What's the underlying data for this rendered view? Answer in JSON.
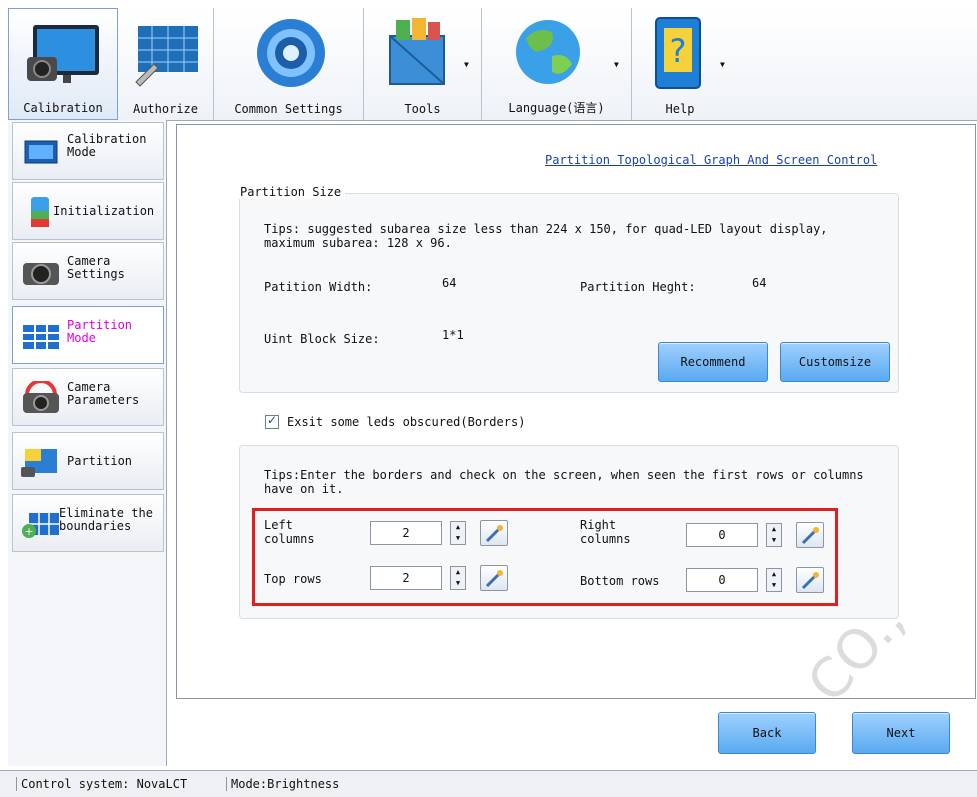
{
  "toolbar": {
    "items": [
      {
        "label": "Calibration",
        "icon": "monitor-camera-icon"
      },
      {
        "label": "Authorize",
        "icon": "screen-wrench-icon"
      },
      {
        "label": "Common Settings",
        "icon": "gear-icon"
      },
      {
        "label": "Tools",
        "icon": "toolbox-icon"
      },
      {
        "label": "Language(语言)",
        "icon": "globe-icon"
      },
      {
        "label": "Help",
        "icon": "help-book-icon"
      }
    ]
  },
  "sidebar": {
    "items": [
      {
        "label": "Calibration\nMode"
      },
      {
        "label": "Initialization"
      },
      {
        "label": "Camera\nSettings"
      },
      {
        "label": "Partition\nMode"
      },
      {
        "label": "Camera\nParameters"
      },
      {
        "label": "Partition"
      },
      {
        "label": "Eliminate the\nboundaries"
      }
    ]
  },
  "main": {
    "top_link": "Partition Topological Graph And Screen Control",
    "partition_size": {
      "title": "Partition Size",
      "tips": "Tips: suggested subarea size less than 224 x 150, for quad-LED layout display, maximum subarea: 128 x 96.",
      "width_label": "Patition Width:",
      "width_value": "64",
      "height_label": "Partition Heght:",
      "height_value": "64",
      "block_label": "Uint Block Size:",
      "block_value": "1*1",
      "recommend_label": "Recommend",
      "customize_label": "Customsize"
    },
    "borders": {
      "checkbox_label": "Exsit some leds obscured(Borders)",
      "checked": true,
      "tips": "Tips:Enter the borders and check on the screen, when seen the first rows or columns have on it.",
      "left_label": "Left\ncolumns",
      "left_value": "2",
      "right_label": "Right\ncolumns",
      "right_value": "0",
      "top_label": "Top rows",
      "top_value": "2",
      "bottom_label": "Bottom rows",
      "bottom_value": "0"
    }
  },
  "footer": {
    "back_label": "Back",
    "next_label": "Next"
  },
  "status": {
    "control_system": "Control system: NovaLCT",
    "mode": "Mode:Brightness"
  },
  "colors": {
    "accent": "#5aaaf0",
    "highlight_border": "#e02020",
    "active_sidebar_text": "#e000e0",
    "link": "#1a3fb0"
  }
}
